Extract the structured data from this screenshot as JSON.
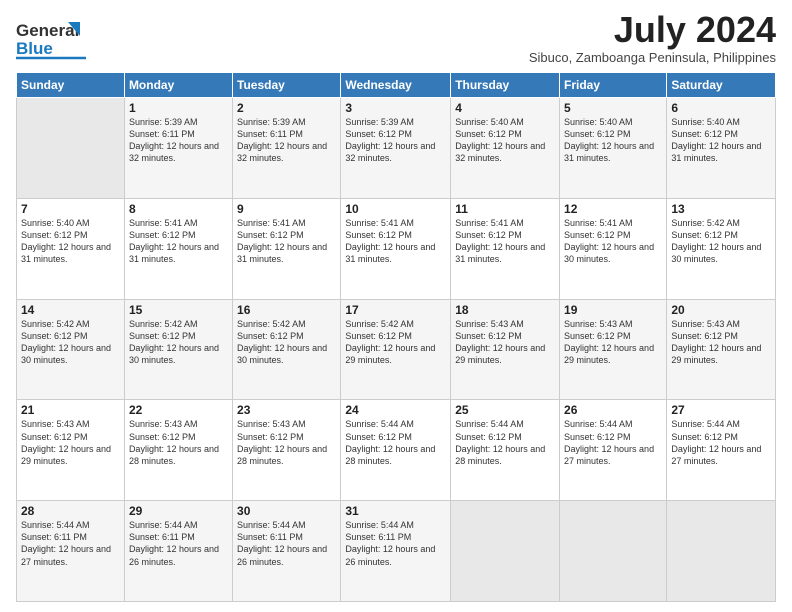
{
  "header": {
    "logo_line1": "General",
    "logo_line2": "Blue",
    "month": "July 2024",
    "location": "Sibuco, Zamboanga Peninsula, Philippines"
  },
  "days_of_week": [
    "Sunday",
    "Monday",
    "Tuesday",
    "Wednesday",
    "Thursday",
    "Friday",
    "Saturday"
  ],
  "weeks": [
    [
      {
        "day": "",
        "sunrise": "",
        "sunset": "",
        "daylight": "",
        "empty": true
      },
      {
        "day": "1",
        "sunrise": "Sunrise: 5:39 AM",
        "sunset": "Sunset: 6:11 PM",
        "daylight": "Daylight: 12 hours and 32 minutes."
      },
      {
        "day": "2",
        "sunrise": "Sunrise: 5:39 AM",
        "sunset": "Sunset: 6:11 PM",
        "daylight": "Daylight: 12 hours and 32 minutes."
      },
      {
        "day": "3",
        "sunrise": "Sunrise: 5:39 AM",
        "sunset": "Sunset: 6:12 PM",
        "daylight": "Daylight: 12 hours and 32 minutes."
      },
      {
        "day": "4",
        "sunrise": "Sunrise: 5:40 AM",
        "sunset": "Sunset: 6:12 PM",
        "daylight": "Daylight: 12 hours and 32 minutes."
      },
      {
        "day": "5",
        "sunrise": "Sunrise: 5:40 AM",
        "sunset": "Sunset: 6:12 PM",
        "daylight": "Daylight: 12 hours and 31 minutes."
      },
      {
        "day": "6",
        "sunrise": "Sunrise: 5:40 AM",
        "sunset": "Sunset: 6:12 PM",
        "daylight": "Daylight: 12 hours and 31 minutes."
      }
    ],
    [
      {
        "day": "7",
        "sunrise": "Sunrise: 5:40 AM",
        "sunset": "Sunset: 6:12 PM",
        "daylight": "Daylight: 12 hours and 31 minutes."
      },
      {
        "day": "8",
        "sunrise": "Sunrise: 5:41 AM",
        "sunset": "Sunset: 6:12 PM",
        "daylight": "Daylight: 12 hours and 31 minutes."
      },
      {
        "day": "9",
        "sunrise": "Sunrise: 5:41 AM",
        "sunset": "Sunset: 6:12 PM",
        "daylight": "Daylight: 12 hours and 31 minutes."
      },
      {
        "day": "10",
        "sunrise": "Sunrise: 5:41 AM",
        "sunset": "Sunset: 6:12 PM",
        "daylight": "Daylight: 12 hours and 31 minutes."
      },
      {
        "day": "11",
        "sunrise": "Sunrise: 5:41 AM",
        "sunset": "Sunset: 6:12 PM",
        "daylight": "Daylight: 12 hours and 31 minutes."
      },
      {
        "day": "12",
        "sunrise": "Sunrise: 5:41 AM",
        "sunset": "Sunset: 6:12 PM",
        "daylight": "Daylight: 12 hours and 30 minutes."
      },
      {
        "day": "13",
        "sunrise": "Sunrise: 5:42 AM",
        "sunset": "Sunset: 6:12 PM",
        "daylight": "Daylight: 12 hours and 30 minutes."
      }
    ],
    [
      {
        "day": "14",
        "sunrise": "Sunrise: 5:42 AM",
        "sunset": "Sunset: 6:12 PM",
        "daylight": "Daylight: 12 hours and 30 minutes."
      },
      {
        "day": "15",
        "sunrise": "Sunrise: 5:42 AM",
        "sunset": "Sunset: 6:12 PM",
        "daylight": "Daylight: 12 hours and 30 minutes."
      },
      {
        "day": "16",
        "sunrise": "Sunrise: 5:42 AM",
        "sunset": "Sunset: 6:12 PM",
        "daylight": "Daylight: 12 hours and 30 minutes."
      },
      {
        "day": "17",
        "sunrise": "Sunrise: 5:42 AM",
        "sunset": "Sunset: 6:12 PM",
        "daylight": "Daylight: 12 hours and 29 minutes."
      },
      {
        "day": "18",
        "sunrise": "Sunrise: 5:43 AM",
        "sunset": "Sunset: 6:12 PM",
        "daylight": "Daylight: 12 hours and 29 minutes."
      },
      {
        "day": "19",
        "sunrise": "Sunrise: 5:43 AM",
        "sunset": "Sunset: 6:12 PM",
        "daylight": "Daylight: 12 hours and 29 minutes."
      },
      {
        "day": "20",
        "sunrise": "Sunrise: 5:43 AM",
        "sunset": "Sunset: 6:12 PM",
        "daylight": "Daylight: 12 hours and 29 minutes."
      }
    ],
    [
      {
        "day": "21",
        "sunrise": "Sunrise: 5:43 AM",
        "sunset": "Sunset: 6:12 PM",
        "daylight": "Daylight: 12 hours and 29 minutes."
      },
      {
        "day": "22",
        "sunrise": "Sunrise: 5:43 AM",
        "sunset": "Sunset: 6:12 PM",
        "daylight": "Daylight: 12 hours and 28 minutes."
      },
      {
        "day": "23",
        "sunrise": "Sunrise: 5:43 AM",
        "sunset": "Sunset: 6:12 PM",
        "daylight": "Daylight: 12 hours and 28 minutes."
      },
      {
        "day": "24",
        "sunrise": "Sunrise: 5:44 AM",
        "sunset": "Sunset: 6:12 PM",
        "daylight": "Daylight: 12 hours and 28 minutes."
      },
      {
        "day": "25",
        "sunrise": "Sunrise: 5:44 AM",
        "sunset": "Sunset: 6:12 PM",
        "daylight": "Daylight: 12 hours and 28 minutes."
      },
      {
        "day": "26",
        "sunrise": "Sunrise: 5:44 AM",
        "sunset": "Sunset: 6:12 PM",
        "daylight": "Daylight: 12 hours and 27 minutes."
      },
      {
        "day": "27",
        "sunrise": "Sunrise: 5:44 AM",
        "sunset": "Sunset: 6:12 PM",
        "daylight": "Daylight: 12 hours and 27 minutes."
      }
    ],
    [
      {
        "day": "28",
        "sunrise": "Sunrise: 5:44 AM",
        "sunset": "Sunset: 6:11 PM",
        "daylight": "Daylight: 12 hours and 27 minutes."
      },
      {
        "day": "29",
        "sunrise": "Sunrise: 5:44 AM",
        "sunset": "Sunset: 6:11 PM",
        "daylight": "Daylight: 12 hours and 26 minutes."
      },
      {
        "day": "30",
        "sunrise": "Sunrise: 5:44 AM",
        "sunset": "Sunset: 6:11 PM",
        "daylight": "Daylight: 12 hours and 26 minutes."
      },
      {
        "day": "31",
        "sunrise": "Sunrise: 5:44 AM",
        "sunset": "Sunset: 6:11 PM",
        "daylight": "Daylight: 12 hours and 26 minutes."
      },
      {
        "day": "",
        "sunrise": "",
        "sunset": "",
        "daylight": "",
        "empty": true
      },
      {
        "day": "",
        "sunrise": "",
        "sunset": "",
        "daylight": "",
        "empty": true
      },
      {
        "day": "",
        "sunrise": "",
        "sunset": "",
        "daylight": "",
        "empty": true
      }
    ]
  ]
}
